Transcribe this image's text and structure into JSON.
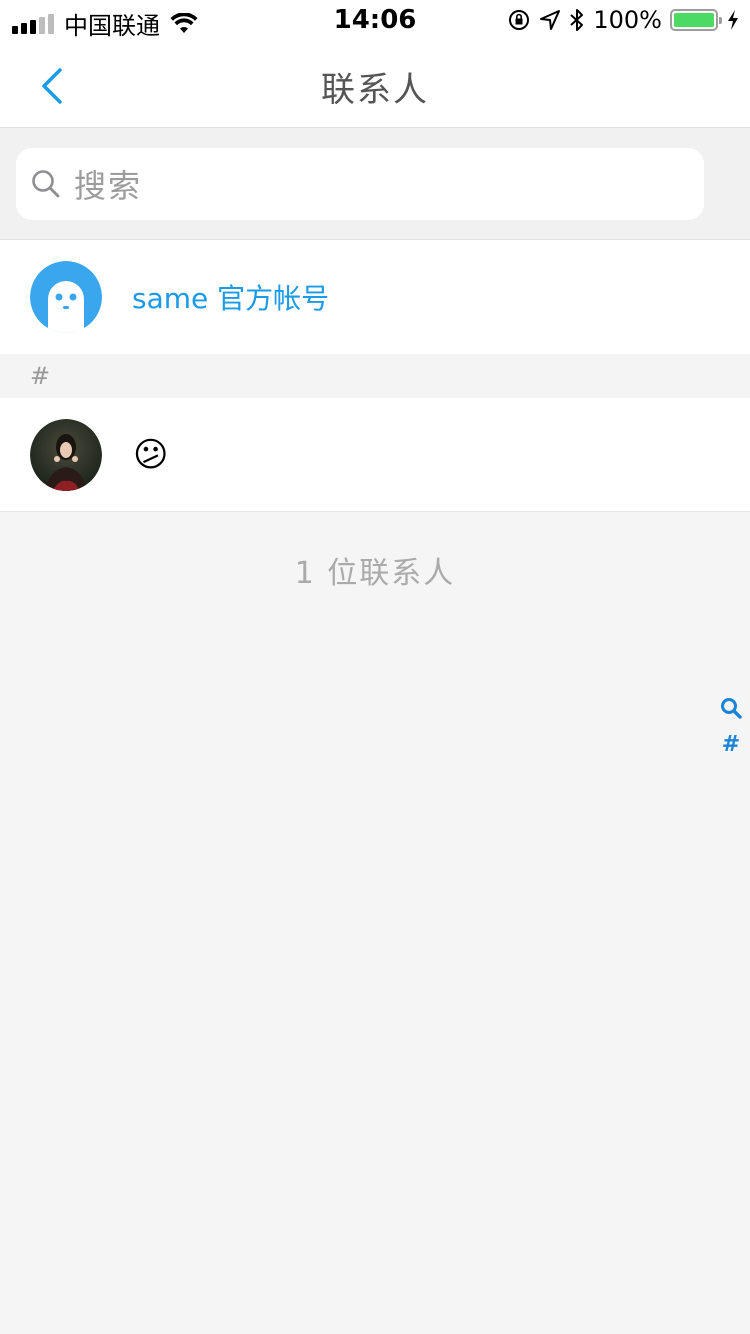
{
  "status_bar": {
    "carrier": "中国联通",
    "time": "14:06",
    "battery": "100%"
  },
  "nav": {
    "title": "联系人"
  },
  "search": {
    "placeholder": "搜索"
  },
  "official_account": {
    "name": "same 官方帐号"
  },
  "section": {
    "header": "#"
  },
  "contacts": [
    {
      "name": "😕"
    }
  ],
  "footer": {
    "count_text": "1 位联系人"
  },
  "index_bar": {
    "items": [
      "search-icon",
      "#"
    ]
  },
  "colors": {
    "accent": "#1a9be8",
    "background": "#f5f5f5"
  }
}
